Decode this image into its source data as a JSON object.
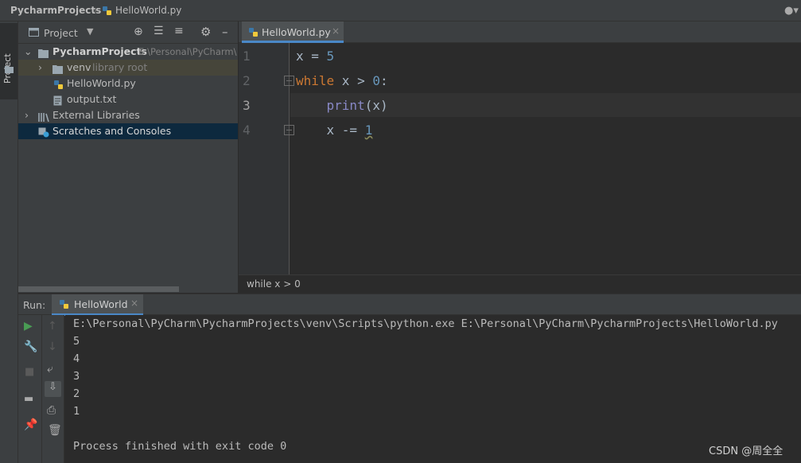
{
  "breadcrumb": {
    "project": "PycharmProjects",
    "file": "HelloWorld.py"
  },
  "side_stripe": {
    "project_tab": "Project"
  },
  "project_panel": {
    "header_label": "Project",
    "tree": [
      {
        "label": "PycharmProjects",
        "hint": "E:\\Personal\\PyCharm\\"
      },
      {
        "label": "venv",
        "hint": "library root"
      },
      {
        "label": "HelloWorld.py",
        "hint": ""
      },
      {
        "label": "output.txt",
        "hint": ""
      },
      {
        "label": "External Libraries",
        "hint": ""
      },
      {
        "label": "Scratches and Consoles",
        "hint": ""
      }
    ]
  },
  "editor": {
    "tab_label": "HelloWorld.py",
    "line_numbers": [
      "1",
      "2",
      "3",
      "4"
    ],
    "lines": [
      {
        "a": "x = ",
        "b": "5"
      },
      {
        "kw": "while",
        "rest": " x > ",
        "num": "0",
        "end": ":"
      },
      {
        "indent": "    ",
        "fn": "print",
        "arg": "(x)"
      },
      {
        "indent": "    x -= ",
        "num": "1"
      }
    ],
    "status_breadcrumb": "while x > 0"
  },
  "run_panel": {
    "label": "Run:",
    "tab_label": "HelloWorld",
    "output": [
      "E:\\Personal\\PyCharm\\PycharmProjects\\venv\\Scripts\\python.exe E:\\Personal\\PyCharm\\PycharmProjects\\HelloWorld.py",
      "5",
      "4",
      "3",
      "2",
      "1",
      "",
      "Process finished with exit code 0"
    ]
  },
  "watermark": "CSDN @周全全",
  "colors": {
    "keyword": "#cc7832",
    "number": "#6897bb",
    "builtin": "#8888c6",
    "selection": "#0d293e",
    "run_green": "#499c54"
  }
}
